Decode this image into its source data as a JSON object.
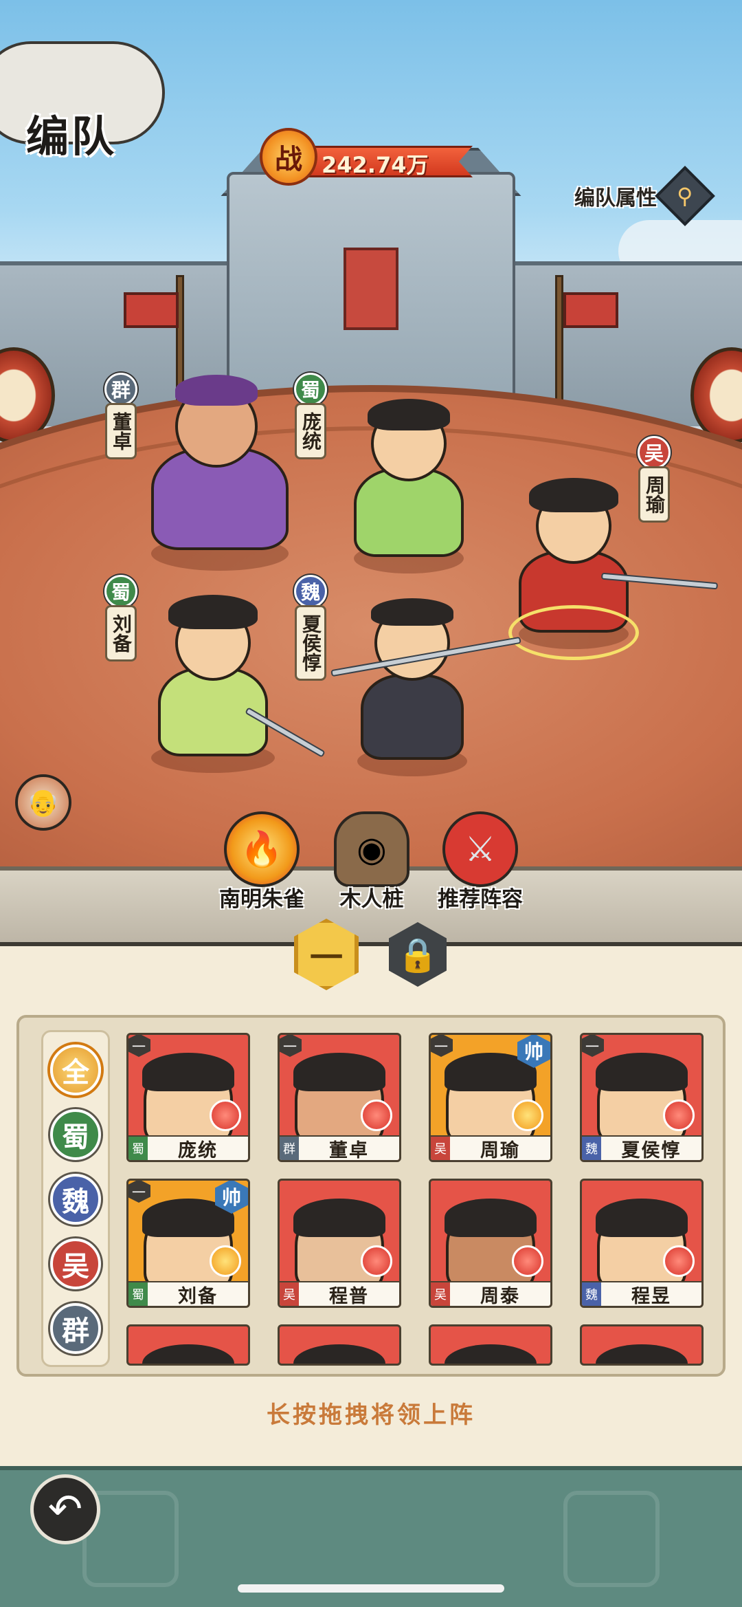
{
  "header": {
    "title": "编队",
    "power_icon_char": "战",
    "power_value": "242.74万",
    "team_attr_label": "编队属性",
    "search_icon": "magnifier-icon"
  },
  "heroes_on_field": [
    {
      "faction": "群",
      "name": "董卓",
      "faction_color": "#5a6a7a"
    },
    {
      "faction": "蜀",
      "name": "庞统",
      "faction_color": "#3f8a4a"
    },
    {
      "faction": "吴",
      "name": "周瑜",
      "faction_color": "#c8453b"
    },
    {
      "faction": "蜀",
      "name": "刘备",
      "faction_color": "#3f8a4a"
    },
    {
      "faction": "魏",
      "name": "夏侯惇",
      "faction_color": "#4a62a8"
    }
  ],
  "assists": [
    {
      "label": "南明朱雀",
      "icon": "phoenix-icon"
    },
    {
      "label": "木人桩",
      "icon": "training-dummy-icon"
    },
    {
      "label": "推荐阵容",
      "icon": "crossed-swords-icon"
    }
  ],
  "team_tabs": [
    {
      "label": "一",
      "active": true
    },
    {
      "label": "lock-icon",
      "active": false
    }
  ],
  "faction_filters": [
    {
      "label": "全",
      "color": "#e59a2a",
      "active": true
    },
    {
      "label": "蜀",
      "color": "#3f8a4a"
    },
    {
      "label": "魏",
      "color": "#4a62a8"
    },
    {
      "label": "吴",
      "color": "#c8453b"
    },
    {
      "label": "群",
      "color": "#5a6a7a"
    }
  ],
  "roster": [
    {
      "name": "庞统",
      "faction": "蜀",
      "faction_color": "#3f8a4a",
      "team": "一",
      "commander": "",
      "rarity": "red"
    },
    {
      "name": "董卓",
      "faction": "群",
      "faction_color": "#5a6a7a",
      "team": "一",
      "commander": "",
      "rarity": "red"
    },
    {
      "name": "周瑜",
      "faction": "吴",
      "faction_color": "#c8453b",
      "team": "一",
      "commander": "帅",
      "rarity": "gold"
    },
    {
      "name": "夏侯惇",
      "faction": "魏",
      "faction_color": "#4a62a8",
      "team": "一",
      "commander": "",
      "rarity": "red"
    },
    {
      "name": "刘备",
      "faction": "蜀",
      "faction_color": "#3f8a4a",
      "team": "一",
      "commander": "帅",
      "rarity": "gold"
    },
    {
      "name": "程普",
      "faction": "吴",
      "faction_color": "#c8453b",
      "team": "",
      "commander": "",
      "rarity": "red"
    },
    {
      "name": "周泰",
      "faction": "吴",
      "faction_color": "#c8453b",
      "team": "",
      "commander": "",
      "rarity": "red"
    },
    {
      "name": "程昱",
      "faction": "魏",
      "faction_color": "#4a62a8",
      "team": "",
      "commander": "",
      "rarity": "red"
    }
  ],
  "hint": "长按拖拽将领上阵",
  "footer": {
    "back_icon": "back-arrow-icon"
  }
}
